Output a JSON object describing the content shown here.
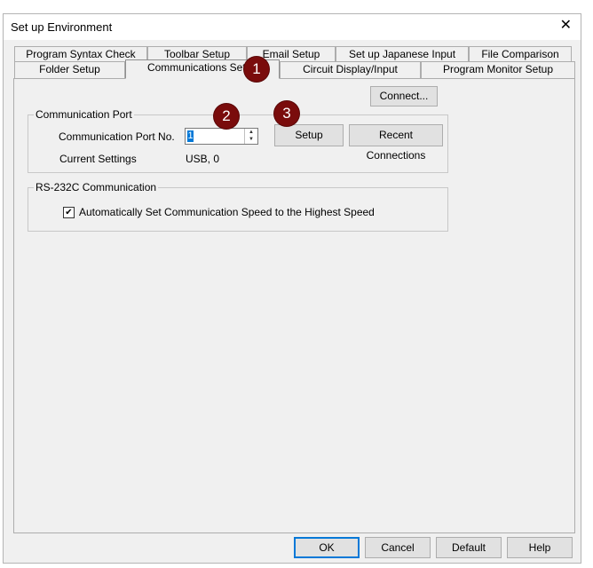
{
  "window": {
    "title": "Set up Environment"
  },
  "tabs_row1": [
    {
      "label": "Program Syntax Check"
    },
    {
      "label": "Toolbar Setup"
    },
    {
      "label": "Email Setup"
    },
    {
      "label": "Set up Japanese Input"
    },
    {
      "label": "File Comparison"
    }
  ],
  "tabs_row2": [
    {
      "label": "Folder Setup"
    },
    {
      "label": "Communications Setup"
    },
    {
      "label": "Circuit Display/Input"
    },
    {
      "label": "Program Monitor Setup"
    }
  ],
  "connect_label": "Connect...",
  "comm_port": {
    "legend": "Communication Port",
    "port_label": "Communication Port No.",
    "port_value": "1",
    "setup_label": "Setup",
    "recent_label": "Recent Connections",
    "settings_label": "Current Settings",
    "settings_value": "USB, 0"
  },
  "rs232": {
    "legend": "RS-232C Communication",
    "auto_speed_label": "Automatically Set Communication Speed to the Highest Speed",
    "auto_speed_checked": true
  },
  "footer": {
    "ok": "OK",
    "cancel": "Cancel",
    "default": "Default",
    "help": "Help"
  },
  "markers": [
    "1",
    "2",
    "3"
  ],
  "colors": {
    "marker": "#7a0c0c",
    "selection": "#0078d7",
    "panel": "#f0f0f0"
  }
}
